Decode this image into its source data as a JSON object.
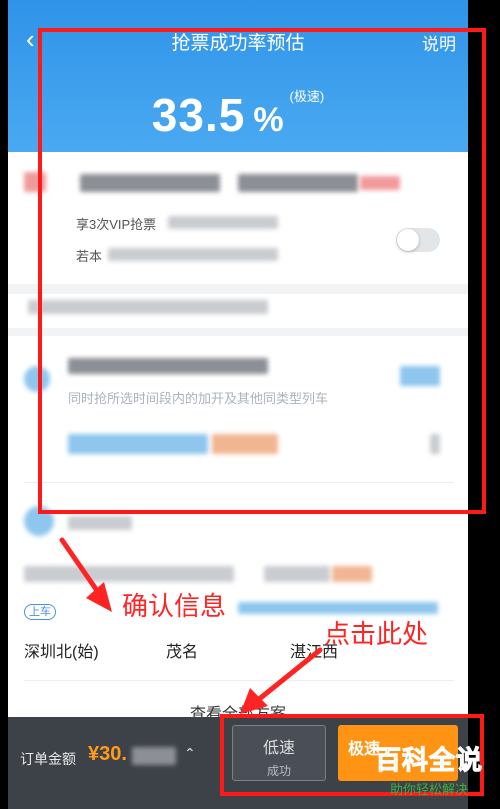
{
  "header": {
    "back_icon": "chevron-left-icon",
    "title": "抢票成功率预估",
    "explain_label": "说明",
    "rate_value": "33.5",
    "rate_unit": "%",
    "rate_note": "(极速)"
  },
  "vip_section": {
    "line1": "享3次VIP抢票",
    "line2": "若本"
  },
  "plan_section": {
    "description": "同时抢所选时间段内的加开及其他同类型列车"
  },
  "route": {
    "board_tag": "上车",
    "stations": [
      "深圳北(始)",
      "茂名",
      "湛江西"
    ],
    "view_all_label": "查看全部方案"
  },
  "bottom_bar": {
    "order_label": "订单金额",
    "order_price": "¥30.",
    "low_speed_label": "低速",
    "low_speed_sub": "成功",
    "fast_speed_label": "极速"
  },
  "annotations": {
    "confirm_info": "确认信息",
    "click_here": "点击此处"
  },
  "watermark": {
    "main": "百科全说",
    "sub": "助你轻松解决"
  },
  "colors": {
    "header_blue": "#3a9df0",
    "accent_orange": "#ff9314",
    "annotation_red": "#ff2424",
    "watermark_green": "#3fae3f"
  }
}
